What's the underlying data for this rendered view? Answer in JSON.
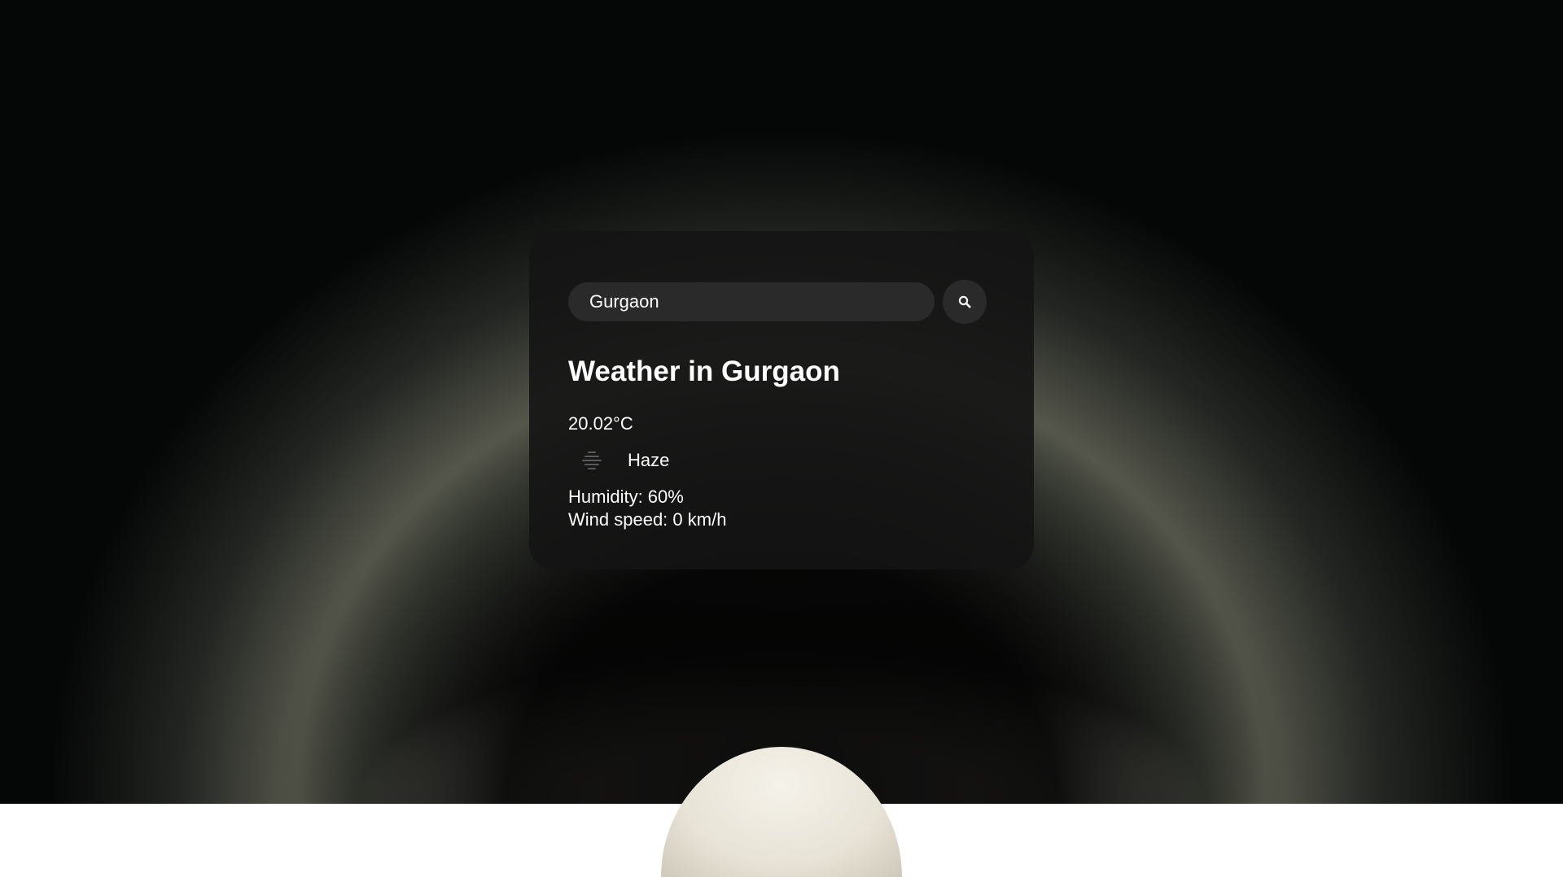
{
  "search": {
    "value": "Gurgaon",
    "placeholder": ""
  },
  "search_button": {
    "icon": "search-icon"
  },
  "weather": {
    "title": "Weather in Gurgaon",
    "temperature": "20.02°C",
    "icon": "haze-icon",
    "description": "Haze",
    "humidity": "Humidity: 60%",
    "wind": "Wind speed: 0 km/h"
  },
  "colors": {
    "card_background": "#141414",
    "input_background": "#2a2a2a",
    "text": "#ffffff"
  }
}
